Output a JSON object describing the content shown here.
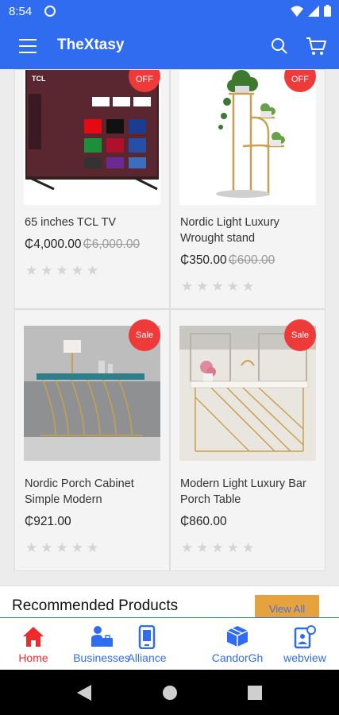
{
  "status_bar": {
    "time": "8:54"
  },
  "app_bar": {
    "title": "TheXtasy"
  },
  "products": [
    {
      "name": "65 inches TCL TV",
      "price": "₵4,000.00",
      "old_price": "₵6,000.00",
      "badge": "OFF",
      "tv_brand": "TCL",
      "rating": 0
    },
    {
      "name": "Nordic Light Luxury Wrought stand",
      "price": "₵350.00",
      "old_price": "₵600.00",
      "badge": "OFF",
      "rating": 0
    },
    {
      "name": "Nordic Porch Cabinet Simple Modern",
      "price": "₵921.00",
      "badge": "Sale",
      "rating": 0
    },
    {
      "name": "Modern Light Luxury Bar Porch Table",
      "price": "₵860.00",
      "badge": "Sale",
      "rating": 0
    }
  ],
  "recommended": {
    "title": "Recommended Products",
    "view_all": "View All"
  },
  "bottom_nav": [
    {
      "label": "Home",
      "icon": "home-icon",
      "active": true
    },
    {
      "label": "Businesses",
      "icon": "business-person-icon"
    },
    {
      "label": "Alliance",
      "icon": "phone-icon"
    },
    {
      "label": "CandorGh",
      "icon": "box-icon"
    },
    {
      "label": "webview",
      "icon": "contact-settings-icon"
    }
  ],
  "colors": {
    "primary": "#2f6cf0",
    "sale_badge": "#ef3a3a",
    "active_nav": "#ef2a2a",
    "view_all_bg": "#e6a23c"
  }
}
